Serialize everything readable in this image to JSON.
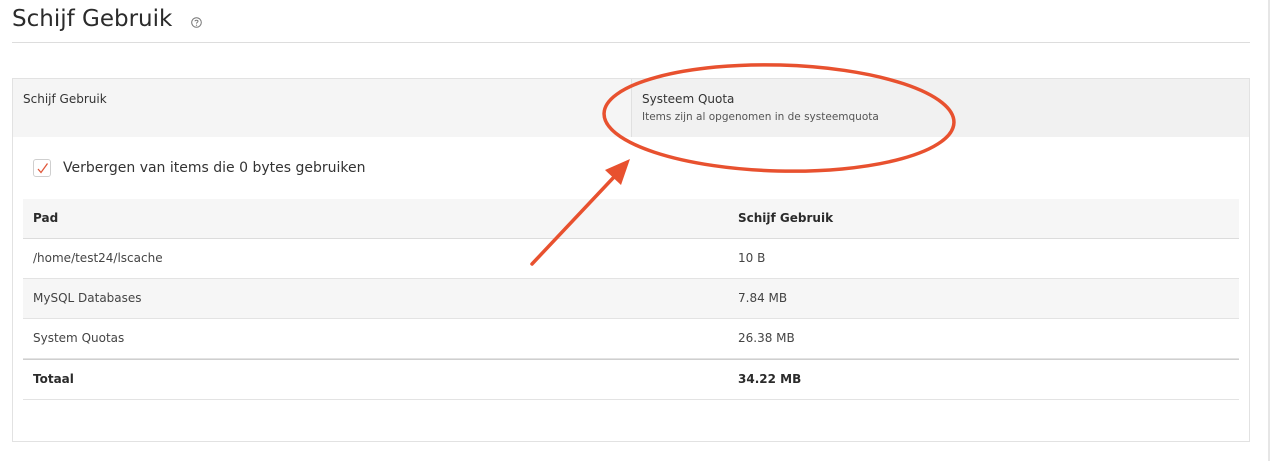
{
  "page": {
    "title": "Schijf Gebruik"
  },
  "tabs": [
    {
      "title": "Schijf Gebruik",
      "subtitle": ""
    },
    {
      "title": "Systeem Quota",
      "subtitle": "Items zijn al opgenomen in de systeemquota"
    }
  ],
  "filter": {
    "label": "Verbergen van items die 0 bytes gebruiken",
    "checked": true
  },
  "table": {
    "headers": {
      "path": "Pad",
      "usage": "Schijf Gebruik"
    },
    "rows": [
      {
        "path": "/home/test24/lscache",
        "usage": "10 B"
      },
      {
        "path": "MySQL Databases",
        "usage": "7.84 MB"
      },
      {
        "path": "System Quotas",
        "usage": "26.38 MB"
      }
    ],
    "total": {
      "path": "Totaal",
      "usage": "34.22 MB"
    }
  },
  "colors": {
    "accent": "#e8512f",
    "check": "#e0573a"
  },
  "icons": {
    "help": "help-circle-icon",
    "check": "checkmark-icon"
  }
}
